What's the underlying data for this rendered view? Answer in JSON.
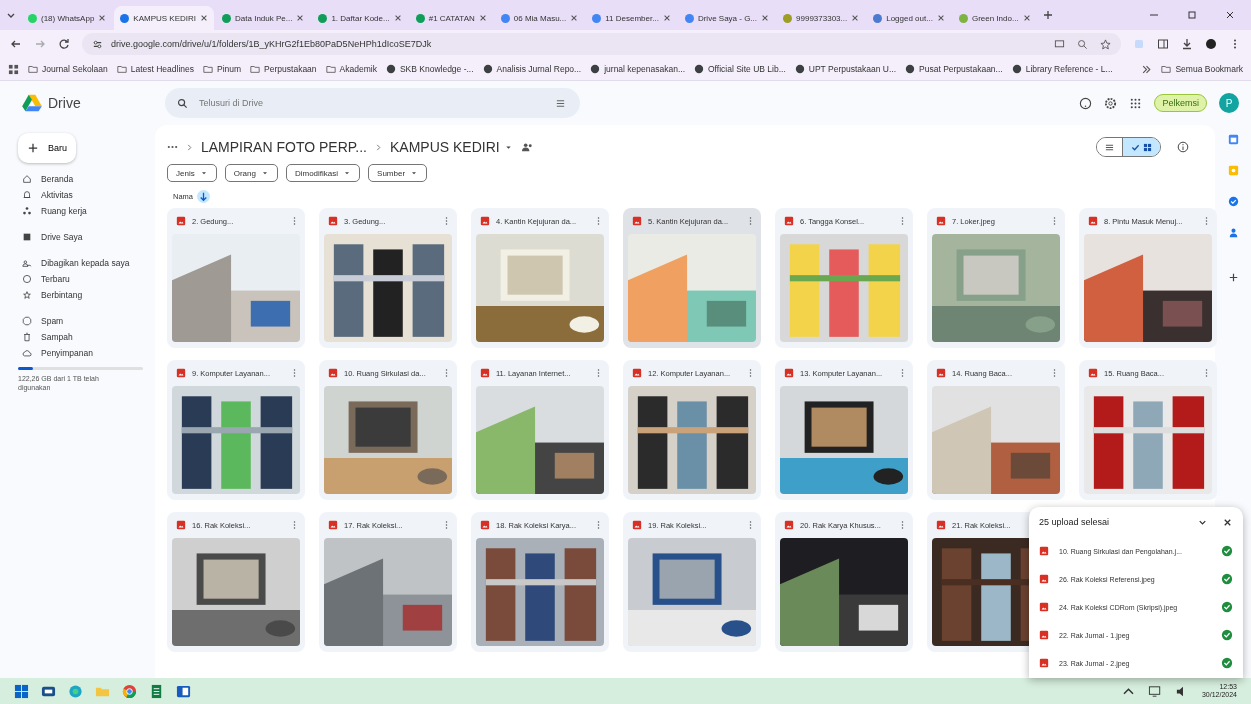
{
  "browser": {
    "tabs": [
      {
        "title": "(18) WhatsApp",
        "selected": false,
        "color": "#25d366"
      },
      {
        "title": "KAMPUS KEDIRI",
        "selected": true,
        "color": "#1a73e8"
      },
      {
        "title": "Data Induk Pe...",
        "selected": false,
        "color": "#0f9d58"
      },
      {
        "title": "1. Daftar Kode...",
        "selected": false,
        "color": "#0f9d58"
      },
      {
        "title": "#1 CATATAN",
        "selected": false,
        "color": "#0f9d58"
      },
      {
        "title": "06 Mia Masu...",
        "selected": false,
        "color": "#4285f4"
      },
      {
        "title": "11 Desember...",
        "selected": false,
        "color": "#4285f4"
      },
      {
        "title": "Drive Saya - G...",
        "selected": false,
        "color": "#4285f4"
      },
      {
        "title": "9999373303...",
        "selected": false,
        "color": "#9e9d24"
      },
      {
        "title": "Logged out...",
        "selected": false,
        "color": "#4a7bd0"
      },
      {
        "title": "Green Indo...",
        "selected": false,
        "color": "#7cb342"
      }
    ],
    "url": "drive.google.com/drive/u/1/folders/1B_yKHrG2f1Eb80PaD5NeHPh1dIcoSE7DJk",
    "bookmarks": [
      {
        "label": "Journal Sekolaan",
        "kind": "folder"
      },
      {
        "label": "Latest Headlines",
        "kind": "folder"
      },
      {
        "label": "Pinum",
        "kind": "folder"
      },
      {
        "label": "Perpustakaan",
        "kind": "folder"
      },
      {
        "label": "Akademik",
        "kind": "folder"
      },
      {
        "label": "SKB Knowledge -...",
        "kind": "site"
      },
      {
        "label": "Analisis Jurnal Repo...",
        "kind": "site"
      },
      {
        "label": "jurnal kepenasakan...",
        "kind": "site"
      },
      {
        "label": "Official Site UB Lib...",
        "kind": "site"
      },
      {
        "label": "UPT Perpustakaan U...",
        "kind": "site"
      },
      {
        "label": "Pusat Perpustakaan...",
        "kind": "site"
      },
      {
        "label": "Library Reference - L...",
        "kind": "site"
      }
    ],
    "all_bookmarks": "Semua Bookmark"
  },
  "drive": {
    "app_name": "Drive",
    "search_placeholder": "Telusuri di Drive",
    "account_label": "Pelkemsi",
    "avatar_letter": "P",
    "new_button": "Baru",
    "sidebar": [
      [
        {
          "label": "Beranda",
          "selected": false
        },
        {
          "label": "Aktivitas",
          "selected": false
        },
        {
          "label": "Ruang kerja",
          "selected": false
        }
      ],
      [
        {
          "label": "Drive Saya",
          "selected": false
        }
      ],
      [
        {
          "label": "Dibagikan kepada saya",
          "selected": false
        },
        {
          "label": "Terbaru",
          "selected": false
        },
        {
          "label": "Berbintang",
          "selected": false
        }
      ],
      [
        {
          "label": "Spam",
          "selected": false
        },
        {
          "label": "Sampah",
          "selected": false
        },
        {
          "label": "Penyimpanan",
          "selected": false
        }
      ]
    ],
    "storage": {
      "level": 0.12,
      "text": "122,26 GB dari 1 TB telah digunakan"
    },
    "breadcrumb": [
      "LAMPIRAN FOTO PERP...",
      "KAMPUS KEDIRI"
    ],
    "view_toggle": [
      {
        "kind": "list",
        "selected": false
      },
      {
        "kind": "grid",
        "selected": true
      }
    ],
    "filters": [
      "Jenis",
      "Orang",
      "Dimodifikasi",
      "Sumber"
    ],
    "sort": "Nama",
    "files": [
      {
        "name": "2. Gedung...",
        "selected": false
      },
      {
        "name": "3. Gedung...",
        "selected": false
      },
      {
        "name": "4. Kantin Kejujuran da...",
        "selected": false
      },
      {
        "name": "5. Kantin Kejujuran da...",
        "selected": true
      },
      {
        "name": "6. Tangga Konsel...",
        "selected": false
      },
      {
        "name": "7. Loker.jpeg",
        "selected": false
      },
      {
        "name": "8. Pintu Masuk Menuj...",
        "selected": false
      },
      {
        "name": "9. Komputer Layanan...",
        "selected": false
      },
      {
        "name": "10. Ruang Sirkulasi da...",
        "selected": false
      },
      {
        "name": "11. Layanan Internet...",
        "selected": false
      },
      {
        "name": "12. Komputer Layanan...",
        "selected": false
      },
      {
        "name": "13. Komputer Layanan...",
        "selected": false
      },
      {
        "name": "14. Ruang Baca...",
        "selected": false
      },
      {
        "name": "15. Ruang Baca...",
        "selected": false
      },
      {
        "name": "16. Rak Koleksi...",
        "selected": false
      },
      {
        "name": "17. Rak Koleksi...",
        "selected": false
      },
      {
        "name": "18. Rak Koleksi Karya...",
        "selected": false
      },
      {
        "name": "19. Rak Koleksi...",
        "selected": false
      },
      {
        "name": "20. Rak Karya Khusus...",
        "selected": false
      },
      {
        "name": "21. Rak Koleksi...",
        "selected": false
      }
    ],
    "upload_panel": {
      "title": "25 upload selesai",
      "items": [
        {
          "name": "10. Ruang Sirkulasi dan Pengolahan.j...",
          "done": true
        },
        {
          "name": "26. Rak Koleksi Referensi.jpeg",
          "done": true
        },
        {
          "name": "24. Rak Koleksi CDRom (Skripsi).jpeg",
          "done": true
        },
        {
          "name": "22. Rak Jurnal - 1.jpeg",
          "done": true
        },
        {
          "name": "23. Rak Jurnal - 2.jpeg",
          "done": true
        }
      ]
    }
  },
  "taskbar": {
    "time": "12:53",
    "date": "30/12/2024"
  }
}
